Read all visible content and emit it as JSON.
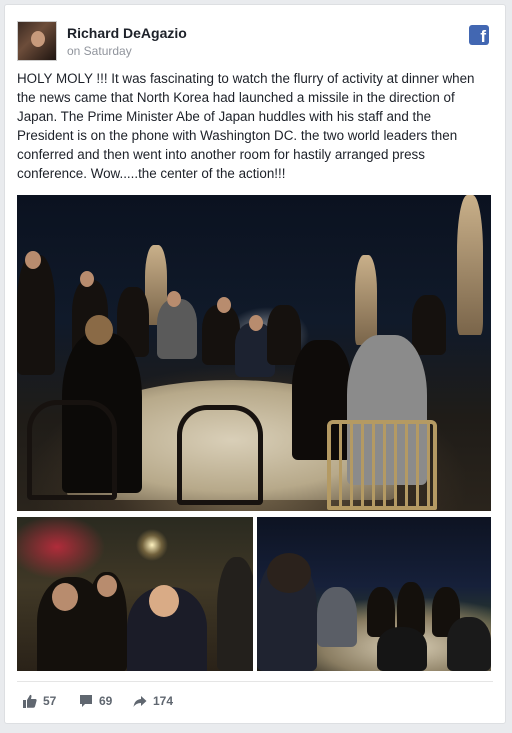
{
  "post": {
    "author": "Richard DeAgazio",
    "timestamp": "on Saturday",
    "text": "HOLY MOLY !!! It was fascinating to watch the flurry of activity at dinner when the news came that North Korea had launched a missile in the direction of Japan. The Prime Minister Abe of Japan huddles with his staff and the President is on the phone with Washington DC. the two world leaders then conferred and then went into another room for hastily arranged press conference. Wow.....the center of the action!!!"
  },
  "brand": {
    "icon": "facebook-icon",
    "glyph": "f",
    "color": "#4267b2"
  },
  "actions": {
    "likes": "57",
    "comments": "69",
    "shares": "174"
  },
  "icons": {
    "like": "thumbs-up-icon",
    "comment": "comment-bubble-icon",
    "share": "share-arrow-icon"
  }
}
